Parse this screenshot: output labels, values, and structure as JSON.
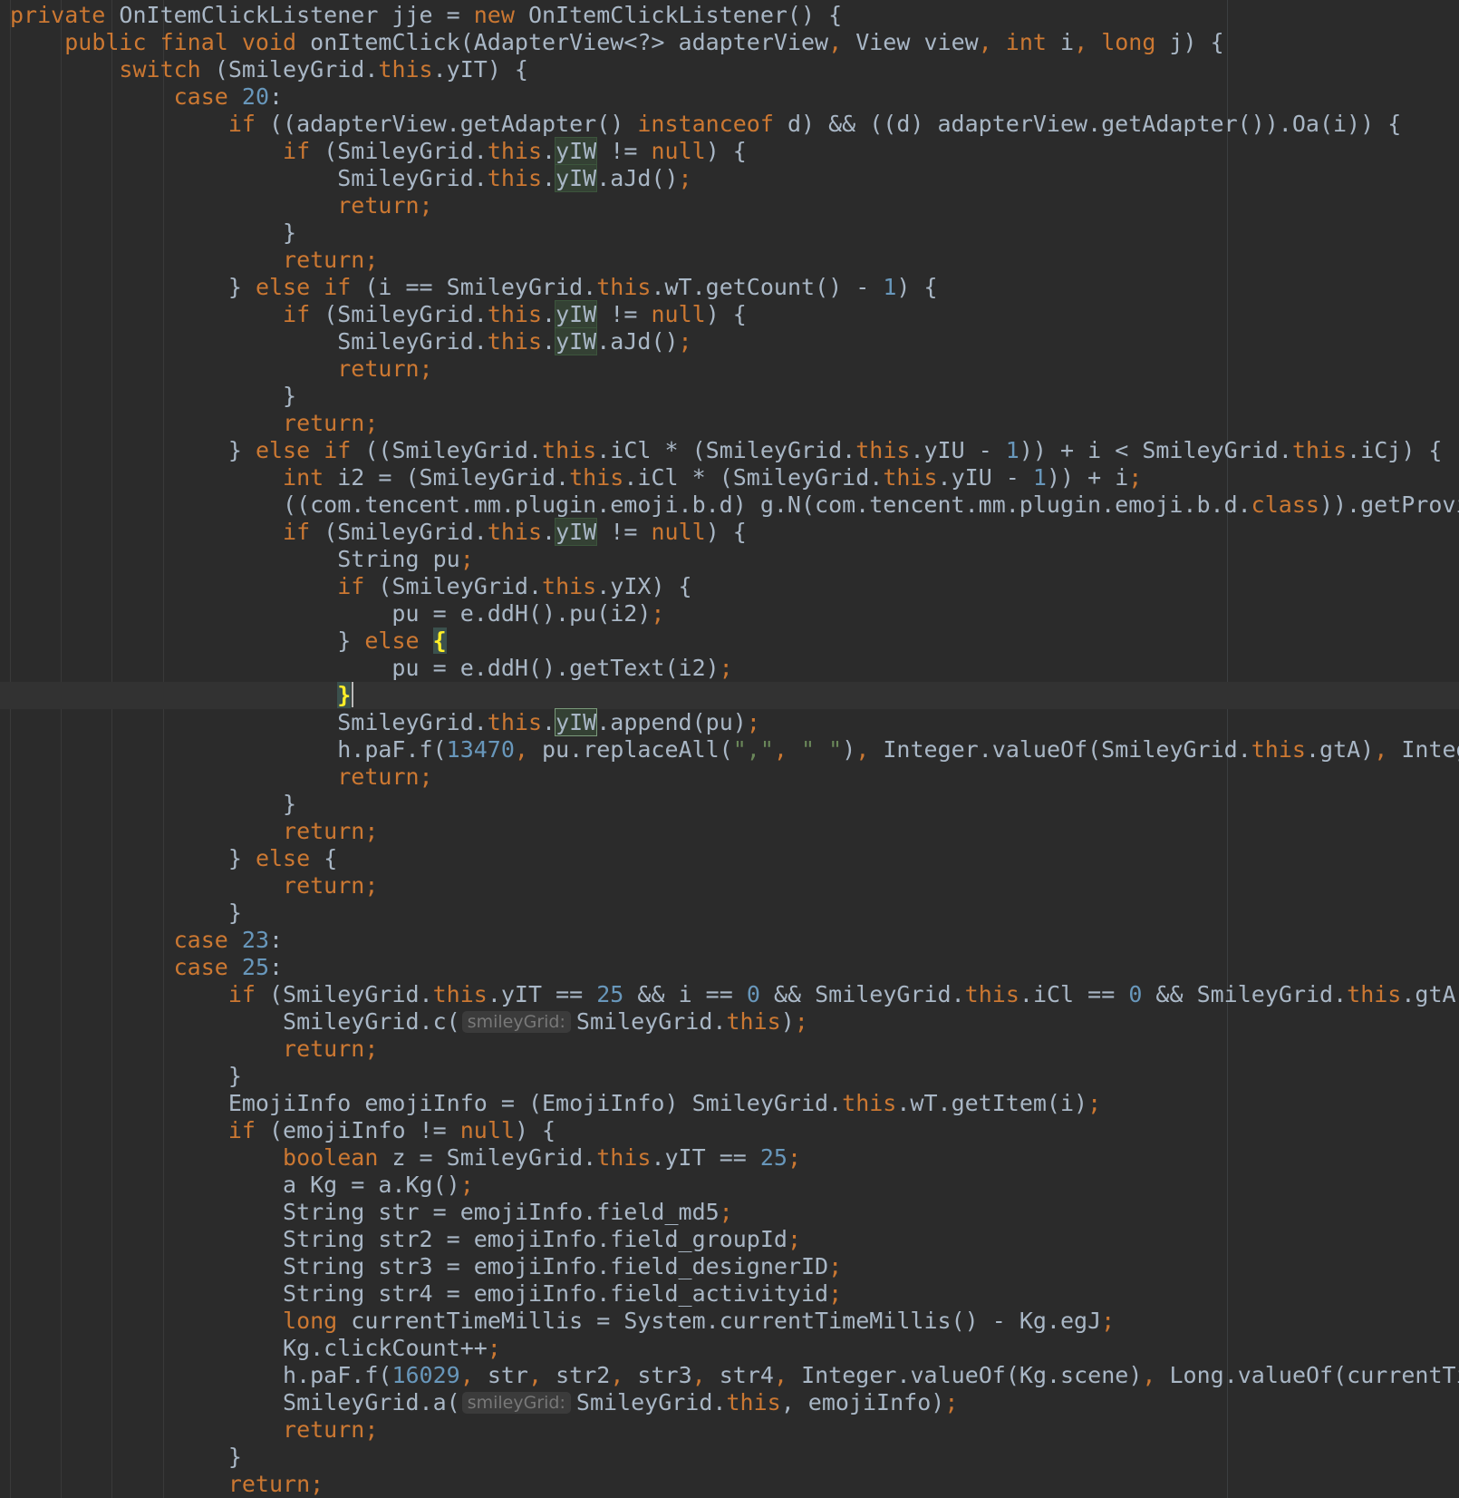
{
  "editor": {
    "lines": [
      [
        {
          "t": "private",
          "c": "kw"
        },
        {
          "t": " OnItemClickListener jje = "
        },
        {
          "t": "new",
          "c": "kw"
        },
        {
          "t": " OnItemClickListener() {"
        }
      ],
      [
        {
          "t": "    "
        },
        {
          "t": "public final void",
          "c": "kw"
        },
        {
          "t": " onItemClick(AdapterView<?> adapterView"
        },
        {
          "t": ",",
          "c": "kw"
        },
        {
          "t": " View view"
        },
        {
          "t": ",",
          "c": "kw"
        },
        {
          "t": " "
        },
        {
          "t": "int",
          "c": "kw"
        },
        {
          "t": " i"
        },
        {
          "t": ",",
          "c": "kw"
        },
        {
          "t": " "
        },
        {
          "t": "long",
          "c": "kw"
        },
        {
          "t": " j) {"
        }
      ],
      [
        {
          "t": "        "
        },
        {
          "t": "switch",
          "c": "kw"
        },
        {
          "t": " (SmileyGrid."
        },
        {
          "t": "this",
          "c": "kw"
        },
        {
          "t": ".yIT) {"
        }
      ],
      [
        {
          "t": "            "
        },
        {
          "t": "case",
          "c": "kw"
        },
        {
          "t": " "
        },
        {
          "t": "20",
          "c": "num"
        },
        {
          "t": ":"
        }
      ],
      [
        {
          "t": "                "
        },
        {
          "t": "if",
          "c": "kw"
        },
        {
          "t": " ((adapterView.getAdapter() "
        },
        {
          "t": "instanceof",
          "c": "kw"
        },
        {
          "t": " d) && ((d) adapterView.getAdapter()).Oa(i)) {"
        }
      ],
      [
        {
          "t": "                    "
        },
        {
          "t": "if",
          "c": "kw"
        },
        {
          "t": " (SmileyGrid."
        },
        {
          "t": "this",
          "c": "kw"
        },
        {
          "t": "."
        },
        {
          "t": "yIW",
          "c": "hl"
        },
        {
          "t": " != "
        },
        {
          "t": "null",
          "c": "kw"
        },
        {
          "t": ") {"
        }
      ],
      [
        {
          "t": "                        SmileyGrid."
        },
        {
          "t": "this",
          "c": "kw"
        },
        {
          "t": "."
        },
        {
          "t": "yIW",
          "c": "hl"
        },
        {
          "t": ".aJd()"
        },
        {
          "t": ";",
          "c": "kw"
        }
      ],
      [
        {
          "t": "                        "
        },
        {
          "t": "return;",
          "c": "kw"
        }
      ],
      [
        {
          "t": "                    }"
        }
      ],
      [
        {
          "t": "                    "
        },
        {
          "t": "return;",
          "c": "kw"
        }
      ],
      [
        {
          "t": "                } "
        },
        {
          "t": "else if",
          "c": "kw"
        },
        {
          "t": " (i == SmileyGrid."
        },
        {
          "t": "this",
          "c": "kw"
        },
        {
          "t": ".wT.getCount() - "
        },
        {
          "t": "1",
          "c": "num"
        },
        {
          "t": ") {"
        }
      ],
      [
        {
          "t": "                    "
        },
        {
          "t": "if",
          "c": "kw"
        },
        {
          "t": " (SmileyGrid."
        },
        {
          "t": "this",
          "c": "kw"
        },
        {
          "t": "."
        },
        {
          "t": "yIW",
          "c": "hl"
        },
        {
          "t": " != "
        },
        {
          "t": "null",
          "c": "kw"
        },
        {
          "t": ") {"
        }
      ],
      [
        {
          "t": "                        SmileyGrid."
        },
        {
          "t": "this",
          "c": "kw"
        },
        {
          "t": "."
        },
        {
          "t": "yIW",
          "c": "hl"
        },
        {
          "t": ".aJd()"
        },
        {
          "t": ";",
          "c": "kw"
        }
      ],
      [
        {
          "t": "                        "
        },
        {
          "t": "return;",
          "c": "kw"
        }
      ],
      [
        {
          "t": "                    }"
        }
      ],
      [
        {
          "t": "                    "
        },
        {
          "t": "return;",
          "c": "kw"
        }
      ],
      [
        {
          "t": "                } "
        },
        {
          "t": "else if",
          "c": "kw"
        },
        {
          "t": " ((SmileyGrid."
        },
        {
          "t": "this",
          "c": "kw"
        },
        {
          "t": ".iCl * (SmileyGrid."
        },
        {
          "t": "this",
          "c": "kw"
        },
        {
          "t": ".yIU - "
        },
        {
          "t": "1",
          "c": "num"
        },
        {
          "t": ")) + i < SmileyGrid."
        },
        {
          "t": "this",
          "c": "kw"
        },
        {
          "t": ".iCj) {"
        }
      ],
      [
        {
          "t": "                    "
        },
        {
          "t": "int",
          "c": "kw"
        },
        {
          "t": " i2 = (SmileyGrid."
        },
        {
          "t": "this",
          "c": "kw"
        },
        {
          "t": ".iCl * (SmileyGrid."
        },
        {
          "t": "this",
          "c": "kw"
        },
        {
          "t": ".yIU - "
        },
        {
          "t": "1",
          "c": "num"
        },
        {
          "t": ")) + i"
        },
        {
          "t": ";",
          "c": "kw"
        }
      ],
      [
        {
          "t": "                    ((com.tencent.mm.plugin.emoji.b.d) g.N(com.tencent.mm.plugin.emoji.b.d."
        },
        {
          "t": "class",
          "c": "kw"
        },
        {
          "t": ")).getProvider().bM"
        }
      ],
      [
        {
          "t": "                    "
        },
        {
          "t": "if",
          "c": "kw"
        },
        {
          "t": " (SmileyGrid."
        },
        {
          "t": "this",
          "c": "kw"
        },
        {
          "t": "."
        },
        {
          "t": "yIW",
          "c": "hl"
        },
        {
          "t": " != "
        },
        {
          "t": "null",
          "c": "kw"
        },
        {
          "t": ") {"
        }
      ],
      [
        {
          "t": "                        String pu"
        },
        {
          "t": ";",
          "c": "kw"
        }
      ],
      [
        {
          "t": "                        "
        },
        {
          "t": "if",
          "c": "kw"
        },
        {
          "t": " (SmileyGrid."
        },
        {
          "t": "this",
          "c": "kw"
        },
        {
          "t": ".yIX) {"
        }
      ],
      [
        {
          "t": "                            pu = e.ddH().pu(i2)"
        },
        {
          "t": ";",
          "c": "kw"
        }
      ],
      [
        {
          "t": "                        } "
        },
        {
          "t": "else",
          "c": "kw"
        },
        {
          "t": " "
        },
        {
          "t": "{",
          "c": "brace-match"
        }
      ],
      [
        {
          "t": "                            pu = e.ddH().getText(i2)"
        },
        {
          "t": ";",
          "c": "kw"
        }
      ],
      [
        {
          "t": "                        "
        },
        {
          "t": "}",
          "c": "brace-match"
        },
        {
          "t": "",
          "c": "caret"
        }
      ],
      [
        {
          "t": "                        SmileyGrid."
        },
        {
          "t": "this",
          "c": "kw"
        },
        {
          "t": "."
        },
        {
          "t": "yIW",
          "c": "hl-edge"
        },
        {
          "t": ".append(pu)"
        },
        {
          "t": ";",
          "c": "kw"
        }
      ],
      [
        {
          "t": "                        h.paF.f("
        },
        {
          "t": "13470",
          "c": "num"
        },
        {
          "t": ",",
          "c": "kw"
        },
        {
          "t": " pu.replaceAll("
        },
        {
          "t": "\",\"",
          "c": "str"
        },
        {
          "t": ",",
          "c": "kw"
        },
        {
          "t": " "
        },
        {
          "t": "\" \"",
          "c": "str"
        },
        {
          "t": ")"
        },
        {
          "t": ",",
          "c": "kw"
        },
        {
          "t": " Integer.valueOf(SmileyGrid."
        },
        {
          "t": "this",
          "c": "kw"
        },
        {
          "t": ".gtA)"
        },
        {
          "t": ",",
          "c": "kw"
        },
        {
          "t": " Integer.value"
        }
      ],
      [
        {
          "t": "                        "
        },
        {
          "t": "return;",
          "c": "kw"
        }
      ],
      [
        {
          "t": "                    }"
        }
      ],
      [
        {
          "t": "                    "
        },
        {
          "t": "return;",
          "c": "kw"
        }
      ],
      [
        {
          "t": "                } "
        },
        {
          "t": "else",
          "c": "kw"
        },
        {
          "t": " {"
        }
      ],
      [
        {
          "t": "                    "
        },
        {
          "t": "return;",
          "c": "kw"
        }
      ],
      [
        {
          "t": "                }"
        }
      ],
      [
        {
          "t": "            "
        },
        {
          "t": "case",
          "c": "kw"
        },
        {
          "t": " "
        },
        {
          "t": "23",
          "c": "num"
        },
        {
          "t": ":"
        }
      ],
      [
        {
          "t": "            "
        },
        {
          "t": "case",
          "c": "kw"
        },
        {
          "t": " "
        },
        {
          "t": "25",
          "c": "num"
        },
        {
          "t": ":"
        }
      ],
      [
        {
          "t": "                "
        },
        {
          "t": "if",
          "c": "kw"
        },
        {
          "t": " (SmileyGrid."
        },
        {
          "t": "this",
          "c": "kw"
        },
        {
          "t": ".yIT == "
        },
        {
          "t": "25",
          "c": "num"
        },
        {
          "t": " && i == "
        },
        {
          "t": "0",
          "c": "num"
        },
        {
          "t": " && SmileyGrid."
        },
        {
          "t": "this",
          "c": "kw"
        },
        {
          "t": ".iCl == "
        },
        {
          "t": "0",
          "c": "num"
        },
        {
          "t": " && SmileyGrid."
        },
        {
          "t": "this",
          "c": "kw"
        },
        {
          "t": ".gtA != ChatF"
        }
      ],
      [
        {
          "t": "                    SmileyGrid.c("
        },
        {
          "t": "smileyGrid:",
          "c": "hint"
        },
        {
          "t": "SmileyGrid."
        },
        {
          "t": "this",
          "c": "kw"
        },
        {
          "t": ")"
        },
        {
          "t": ";",
          "c": "kw"
        }
      ],
      [
        {
          "t": "                    "
        },
        {
          "t": "return;",
          "c": "kw"
        }
      ],
      [
        {
          "t": "                }"
        }
      ],
      [
        {
          "t": "                EmojiInfo emojiInfo = (EmojiInfo) SmileyGrid."
        },
        {
          "t": "this",
          "c": "kw"
        },
        {
          "t": ".wT.getItem(i)"
        },
        {
          "t": ";",
          "c": "kw"
        }
      ],
      [
        {
          "t": "                "
        },
        {
          "t": "if",
          "c": "kw"
        },
        {
          "t": " (emojiInfo != "
        },
        {
          "t": "null",
          "c": "kw"
        },
        {
          "t": ") {"
        }
      ],
      [
        {
          "t": "                    "
        },
        {
          "t": "boolean",
          "c": "kw"
        },
        {
          "t": " z = SmileyGrid."
        },
        {
          "t": "this",
          "c": "kw"
        },
        {
          "t": ".yIT == "
        },
        {
          "t": "25",
          "c": "num"
        },
        {
          "t": ";",
          "c": "kw"
        }
      ],
      [
        {
          "t": "                    a Kg = a.Kg()"
        },
        {
          "t": ";",
          "c": "kw"
        }
      ],
      [
        {
          "t": "                    String str = emojiInfo.field_md5"
        },
        {
          "t": ";",
          "c": "kw"
        }
      ],
      [
        {
          "t": "                    String str2 = emojiInfo.field_groupId"
        },
        {
          "t": ";",
          "c": "kw"
        }
      ],
      [
        {
          "t": "                    String str3 = emojiInfo.field_designerID"
        },
        {
          "t": ";",
          "c": "kw"
        }
      ],
      [
        {
          "t": "                    String str4 = emojiInfo.field_activityid"
        },
        {
          "t": ";",
          "c": "kw"
        }
      ],
      [
        {
          "t": "                    "
        },
        {
          "t": "long",
          "c": "kw"
        },
        {
          "t": " currentTimeMillis = System.currentTimeMillis() - Kg.egJ"
        },
        {
          "t": ";",
          "c": "kw"
        }
      ],
      [
        {
          "t": "                    Kg.clickCount++"
        },
        {
          "t": ";",
          "c": "kw"
        }
      ],
      [
        {
          "t": "                    h.paF.f("
        },
        {
          "t": "16029",
          "c": "num"
        },
        {
          "t": ",",
          "c": "kw"
        },
        {
          "t": " str"
        },
        {
          "t": ",",
          "c": "kw"
        },
        {
          "t": " str2"
        },
        {
          "t": ",",
          "c": "kw"
        },
        {
          "t": " str3"
        },
        {
          "t": ",",
          "c": "kw"
        },
        {
          "t": " str4"
        },
        {
          "t": ",",
          "c": "kw"
        },
        {
          "t": " Integer.valueOf(Kg.scene)"
        },
        {
          "t": ",",
          "c": "kw"
        },
        {
          "t": " Long.valueOf(currentTimeMillis"
        }
      ],
      [
        {
          "t": "                    SmileyGrid.a("
        },
        {
          "t": "smileyGrid:",
          "c": "hint"
        },
        {
          "t": "SmileyGrid."
        },
        {
          "t": "this",
          "c": "kw"
        },
        {
          "t": ","
        },
        {
          "t": " emojiInfo)"
        },
        {
          "t": ";",
          "c": "kw"
        }
      ],
      [
        {
          "t": "                    "
        },
        {
          "t": "return;",
          "c": "kw"
        }
      ],
      [
        {
          "t": "                }"
        }
      ],
      [
        {
          "t": "                "
        },
        {
          "t": "return;",
          "c": "kw"
        }
      ]
    ],
    "current_line": 25,
    "colors": {
      "background": "#2b2b2b",
      "default_text": "#a9b7c6",
      "keyword": "#cc7832",
      "number": "#6897bb",
      "string": "#6a8759",
      "usage_highlight": "#344134",
      "brace_match": "#ffef28"
    }
  }
}
